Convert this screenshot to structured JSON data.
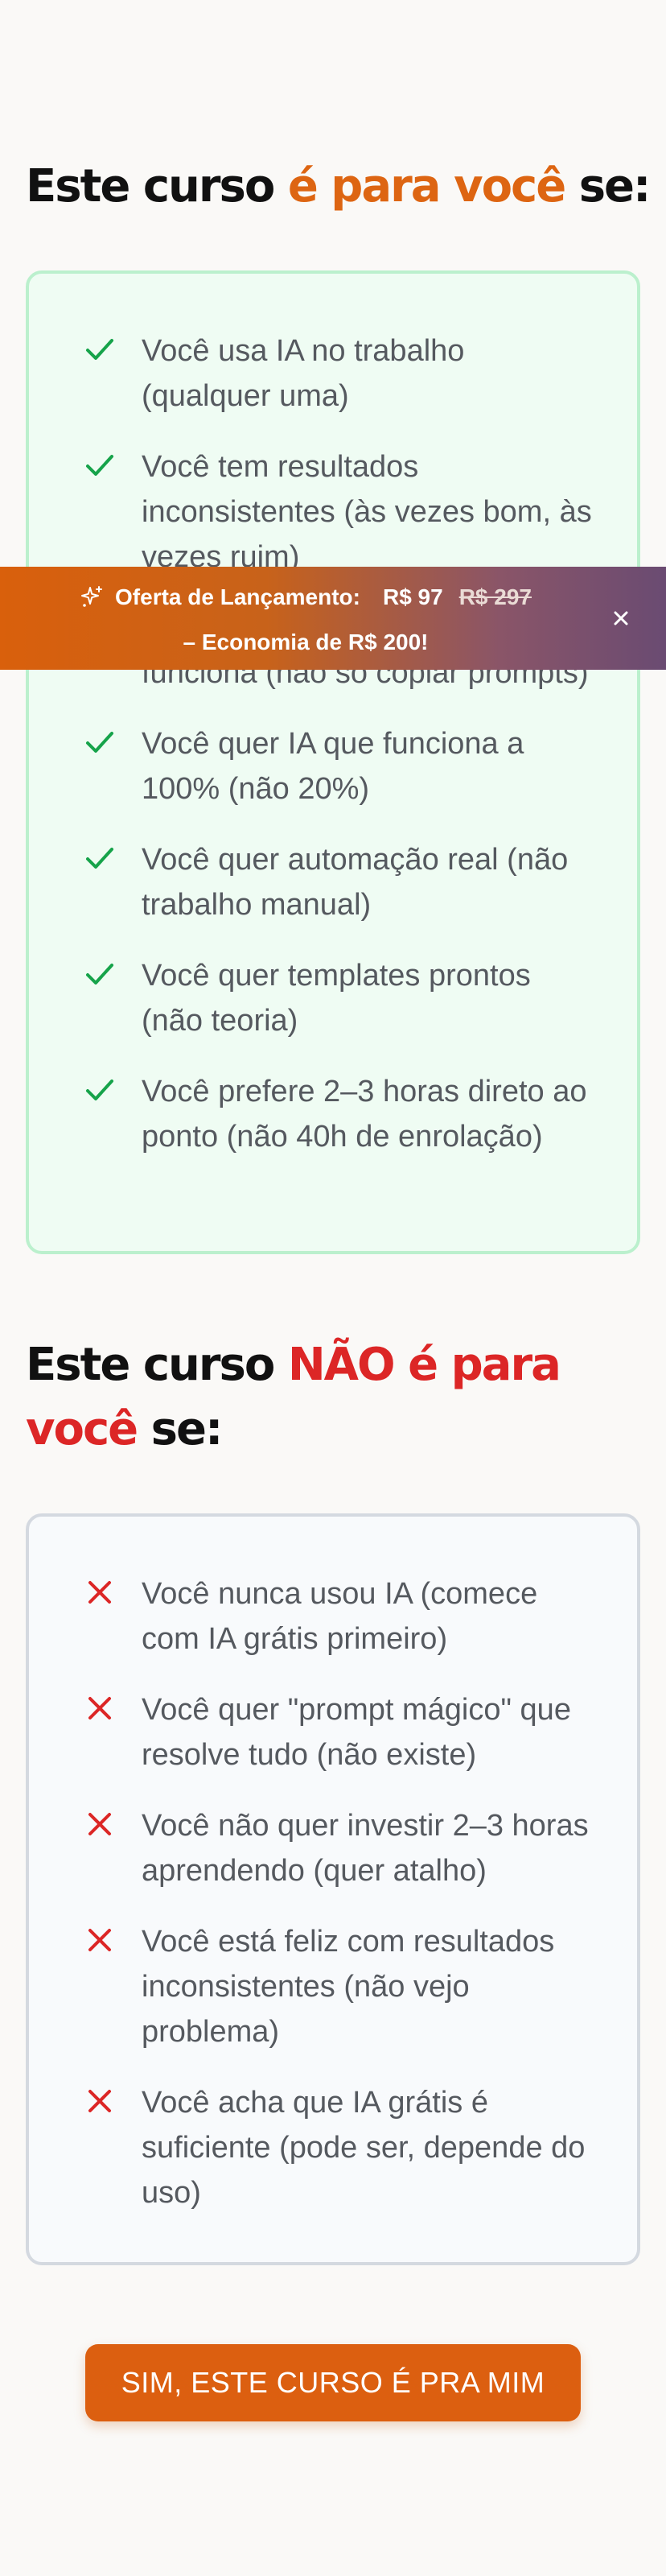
{
  "section_yes": {
    "title_prefix": "Este curso ",
    "title_highlight": "é para você",
    "title_suffix": " se:",
    "icon": "check-icon",
    "icon_color": "#16a34a",
    "items": [
      "Você usa IA no trabalho (qualquer uma)",
      "Você tem resultados inconsistentes (às vezes bom, às vezes ruim)",
      "Você quer entender o que funciona (não só copiar prompts)",
      "Você quer IA que funciona a 100% (não 20%)",
      "Você quer automação real (não trabalho manual)",
      "Você quer templates prontos (não teoria)",
      "Você prefere 2–3 horas direto ao ponto (não 40h de enrolação)"
    ]
  },
  "section_no": {
    "title_prefix": "Este curso ",
    "title_highlight": "NÃO é para você",
    "title_suffix": " se:",
    "icon": "x-icon",
    "icon_color": "#dc2626",
    "items": [
      "Você nunca usou IA (comece com IA grátis primeiro)",
      "Você quer \"prompt mágico\" que resolve tudo (não existe)",
      "Você não quer investir 2–3 horas aprendendo (quer atalho)",
      "Você está feliz com resultados inconsistentes (não vejo problema)",
      "Você acha que IA grátis é suficiente (pode ser, depende do uso)"
    ]
  },
  "promo": {
    "label": "Oferta de Lançamento:",
    "price": "R$ 97",
    "old_price": "R$ 297",
    "savings": "– Economia de R$ 200!",
    "icon": "sparkle-icon",
    "close_icon": "close-icon"
  },
  "cta": {
    "label": "SIM, ESTE CURSO É PRA MIM"
  },
  "colors": {
    "accent_orange": "#dd6512",
    "accent_red": "#dc2626",
    "card_yes_bg": "#effcf3",
    "card_yes_border": "#bbf0cd",
    "card_no_bg": "#f8fafc",
    "card_no_border": "#d4d9e0",
    "cta_bg": "#dc5f10"
  }
}
